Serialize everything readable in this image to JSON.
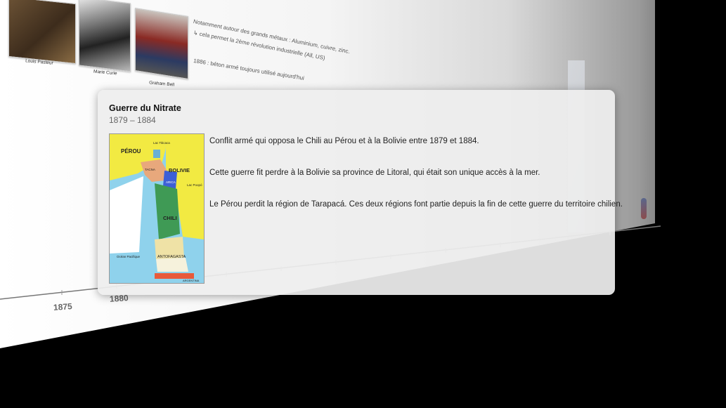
{
  "timeline": {
    "photos": [
      {
        "caption": "Louis Pasteur"
      },
      {
        "caption": "Marie Curie"
      },
      {
        "caption": "Graham Bell"
      }
    ],
    "notes": [
      "Notamment autour des grands métaux : Aluminium, cuivre, zinc.",
      "↳ cela permet la 2ème révolution industrielle (All, US)",
      "1886 : béton armé toujours utilisé aujourd'hui"
    ],
    "ticks": [
      "1875",
      "1880"
    ]
  },
  "popup": {
    "title": "Guerre du Nitrate",
    "dates": "1879 – 1884",
    "paragraphs": [
      "Conflit armé qui opposa le Chili au Pérou et à la Bolivie entre 1879 et 1884.",
      "Cette guerre fit perdre à la Bolivie sa province de Litoral, qui était son unique accès à la mer.",
      "Le Pérou perdit la région de Tarapacá. Ces deux régions font partie depuis la fin de cette guerre du territoire chilien."
    ],
    "map": {
      "labels": {
        "peru": "PÉROU",
        "bolivia": "BOLIVIE",
        "chile": "CHILI",
        "antofagasta": "ANTOFAGASTA",
        "argentina": "ARGENTINA",
        "ocean": "Océan Pacifique",
        "tacna": "TACNA",
        "arica": "ARICA",
        "titicaca": "Lac Titicaca",
        "poopo": "Lac Poopó"
      }
    }
  }
}
